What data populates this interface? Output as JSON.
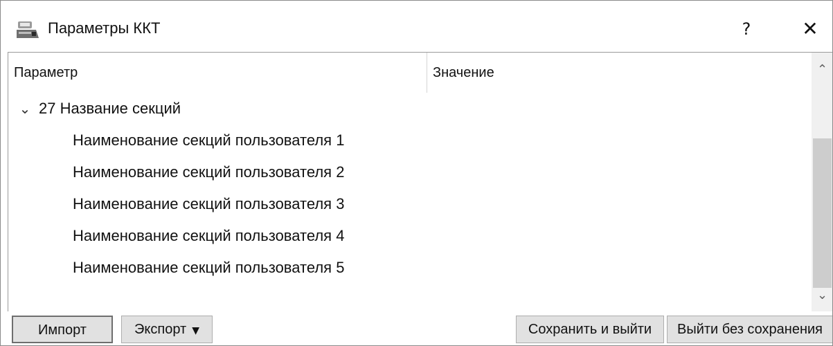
{
  "window": {
    "title": "Параметры ККТ",
    "help_label": "?",
    "close_label": "✕"
  },
  "tree": {
    "columns": [
      "Параметр",
      "Значение"
    ],
    "group": {
      "expand_glyph": "⌄",
      "label": "27 Название секций"
    },
    "items": [
      {
        "label": "Наименование секций пользователя 1",
        "value": ""
      },
      {
        "label": "Наименование секций пользователя 2",
        "value": ""
      },
      {
        "label": "Наименование секций пользователя 3",
        "value": ""
      },
      {
        "label": "Наименование секций пользователя 4",
        "value": ""
      },
      {
        "label": "Наименование секций пользователя 5",
        "value": ""
      }
    ]
  },
  "scrollbar": {
    "up_glyph": "⌃",
    "down_glyph": "⌄"
  },
  "buttons": {
    "import": "Импорт",
    "export": "Экспорт",
    "export_caret": "▼",
    "save_exit": "Сохранить и выйти",
    "exit_no_save": "Выйти без сохранения"
  }
}
